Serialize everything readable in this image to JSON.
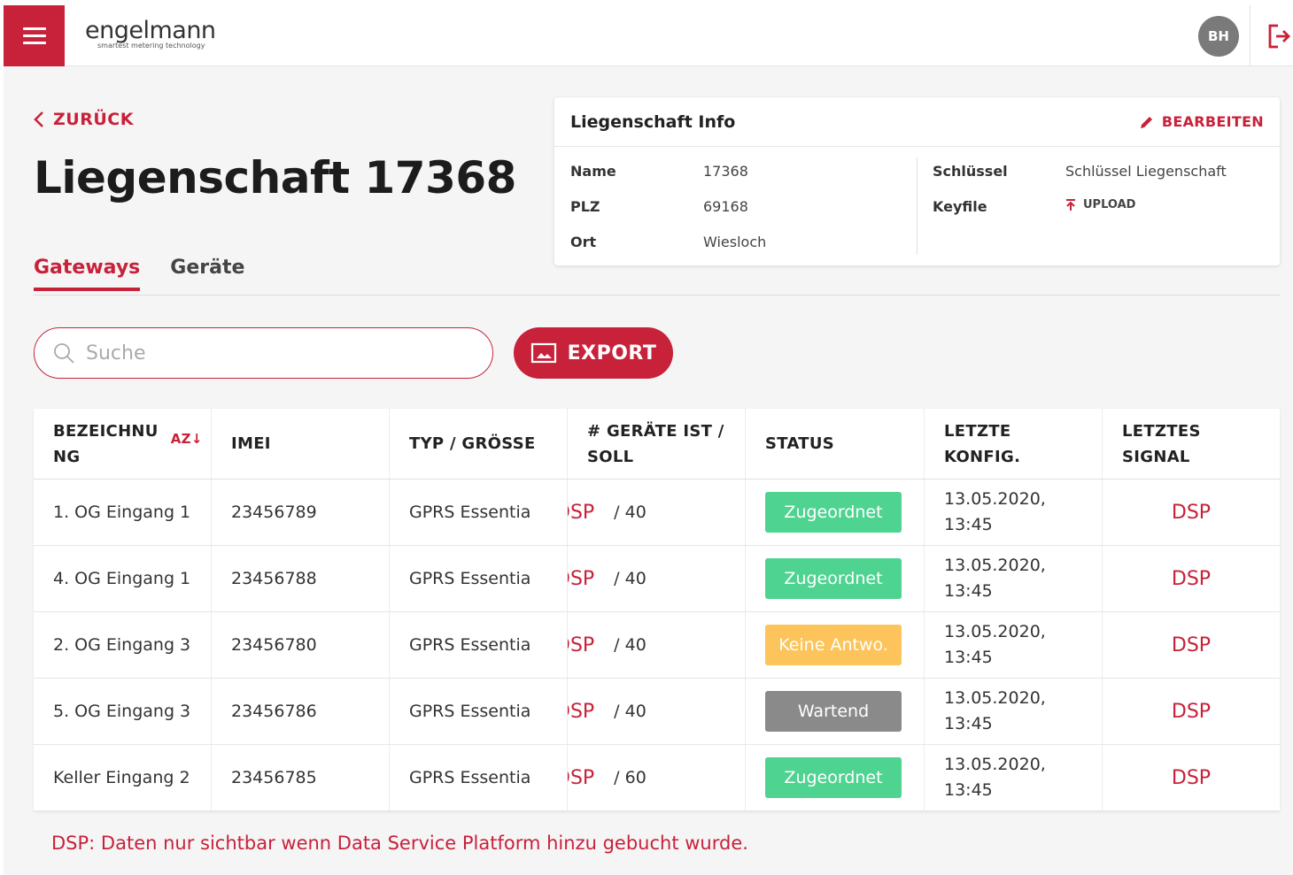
{
  "header": {
    "logo_word": "engelmann",
    "logo_tagline": "smartest metering technology",
    "avatar_initials": "BH"
  },
  "back_label": "ZURÜCK",
  "page_title": "Liegenschaft 17368",
  "tabs": [
    {
      "label": "Gateways",
      "active": true
    },
    {
      "label": "Geräte",
      "active": false
    }
  ],
  "info": {
    "title": "Liegenschaft Info",
    "edit_label": "BEARBEITEN",
    "left": [
      {
        "key": "Name",
        "value": "17368"
      },
      {
        "key": "PLZ",
        "value": "69168"
      },
      {
        "key": "Ort",
        "value": "Wiesloch"
      }
    ],
    "right": {
      "schluessel_key": "Schlüssel",
      "schluessel_value": "Schlüssel Liegenschaft",
      "keyfile_key": "Keyfile",
      "upload_label": "UPLOAD"
    }
  },
  "search": {
    "placeholder": "Suche",
    "value": ""
  },
  "export_label": "EXPORT",
  "table": {
    "columns": [
      {
        "label": "BEZEICHNU NG",
        "line1": "BEZEICHNU",
        "line2": "NG",
        "sort": "AZ"
      },
      {
        "label": "IMEI"
      },
      {
        "label": "TYP / GRÖSSE"
      },
      {
        "label": "# GERÄTE IST / SOLL",
        "line1": "# GERÄTE IST /",
        "line2": "SOLL"
      },
      {
        "label": "STATUS"
      },
      {
        "label": "LETZTE KONFIG.",
        "line1": "LETZTE",
        "line2": "KONFIG."
      },
      {
        "label": "LETZTES SIGNAL",
        "line1": "LETZTES",
        "line2": "SIGNAL"
      }
    ],
    "rows": [
      {
        "name": "1. OG Eingang 1",
        "imei": "23456789",
        "typ": "GPRS Essentia",
        "ist": "DSP",
        "soll": "/ 40",
        "status": "Zugeordnet",
        "status_color": "#4fd391",
        "date": "13.05.2020,",
        "time": "13:45",
        "signal": "DSP"
      },
      {
        "name": "4. OG Eingang 1",
        "imei": "23456788",
        "typ": "GPRS Essentia",
        "ist": "DSP",
        "soll": "/ 40",
        "status": "Zugeordnet",
        "status_color": "#4fd391",
        "date": "13.05.2020,",
        "time": "13:45",
        "signal": "DSP"
      },
      {
        "name": "2. OG Eingang 3",
        "imei": "23456780",
        "typ": "GPRS Essentia",
        "ist": "DSP",
        "soll": "/ 40",
        "status": "Keine Antwo.",
        "status_color": "#fcc45a",
        "date": "13.05.2020,",
        "time": "13:45",
        "signal": "DSP"
      },
      {
        "name": "5. OG Eingang 3",
        "imei": "23456786",
        "typ": "GPRS Essentia",
        "ist": "DSP",
        "soll": "/ 40",
        "status": "Wartend",
        "status_color": "#8a8a8a",
        "date": "13.05.2020,",
        "time": "13:45",
        "signal": "DSP"
      },
      {
        "name": "Keller Eingang 2",
        "imei": "23456785",
        "typ": "GPRS Essentia",
        "ist": "DSP",
        "soll": "/ 60",
        "status": "Zugeordnet",
        "status_color": "#4fd391",
        "date": "13.05.2020,",
        "time": "13:45",
        "signal": "DSP"
      }
    ]
  },
  "footnote": "DSP: Daten nur sichtbar wenn Data Service Platform hinzu gebucht wurde.",
  "colors": {
    "accent": "#c8213a",
    "assigned": "#4fd391",
    "no_answer": "#fcc45a",
    "waiting": "#8a8a8a"
  },
  "icons": [
    "menu-icon",
    "logout-icon",
    "chevron-left-icon",
    "pencil-icon",
    "upload-icon",
    "search-icon",
    "image-icon",
    "sort-icon"
  ]
}
